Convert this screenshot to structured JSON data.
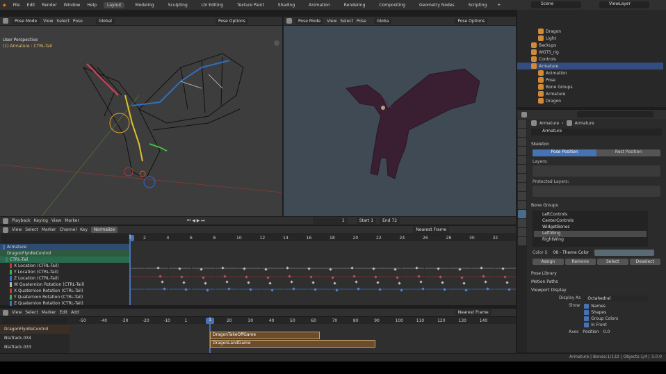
{
  "menu": {
    "items": [
      "File",
      "Edit",
      "Render",
      "Window",
      "Help"
    ],
    "workspaces": [
      "Layout",
      "Modeling",
      "Sculpting",
      "UV Editing",
      "Texture Paint",
      "Shading",
      "Animation",
      "Rendering",
      "Compositing",
      "Geometry Nodes",
      "Scripting"
    ],
    "active_workspace": "Layout",
    "scene": "Scene",
    "view_layer": "ViewLayer",
    "add_tab": "+"
  },
  "viewport_left": {
    "mode": "Pose Mode",
    "menus": [
      "View",
      "Select",
      "Pose"
    ],
    "orientation": "Global",
    "pose_options": "Pose Options",
    "perspective": "User Perspective",
    "object": "(1) Armature : CTRL-Tail"
  },
  "viewport_right": {
    "mode": "Pose Mode",
    "menus": [
      "View",
      "Select",
      "Pose"
    ],
    "orientation": "Globa",
    "pose_options": "Pose Options"
  },
  "outliner": {
    "rows": [
      {
        "name": "Dragon",
        "depth": 2
      },
      {
        "name": "Light",
        "depth": 2
      },
      {
        "name": "Backups",
        "depth": 1
      },
      {
        "name": "WGTS_rig",
        "depth": 1
      },
      {
        "name": "Controls",
        "depth": 1
      },
      {
        "name": "Armature",
        "depth": 1,
        "selected": true
      },
      {
        "name": "Animation",
        "depth": 2
      },
      {
        "name": "Pose",
        "depth": 2
      },
      {
        "name": "Bone Groups",
        "depth": 2
      },
      {
        "name": "Armature",
        "depth": 2
      },
      {
        "name": "Dragon",
        "depth": 2
      }
    ]
  },
  "properties": {
    "breadcrumb_obj": "Armature",
    "breadcrumb_data": "Armature",
    "name_field": "Armature",
    "skeleton": "Skeleton",
    "pose_position": "Pose Position",
    "rest_position": "Rest Position",
    "layers": "Layers:",
    "protected_layers": "Protected Layers:",
    "bone_groups": "Bone Groups",
    "groups": [
      "LeftControls",
      "CenterControls",
      "WidgetBones",
      "LeftWing",
      "RightWing"
    ],
    "selected_group": "LeftWing",
    "color_set_label": "Color S",
    "color_set_value": "08 - Theme Color",
    "buttons": [
      "Assign",
      "Remove",
      "Select",
      "Deselect"
    ],
    "pose_library": "Pose Library",
    "motion_paths": "Motion Paths",
    "viewport_display": "Viewport Display",
    "display_as_label": "Display As",
    "display_as_value": "Octahedral",
    "show_label": "Show",
    "show_items": [
      "Names",
      "Shapes",
      "Group Colors",
      "In Front"
    ],
    "axes_label": "Axes",
    "axes_value": "Position",
    "axes_num": "0.0"
  },
  "dopesheet": {
    "playback": "Playback",
    "keying": "Keying",
    "view": "View",
    "marker": "Marker",
    "current_frame": "1",
    "start_label": "Start",
    "start": "1",
    "end_label": "End",
    "end": "72",
    "menus": [
      "View",
      "Select",
      "Marker",
      "Channel",
      "Key"
    ],
    "mode": "Normalize",
    "snap": "Nearest Frame",
    "ticks": [
      "2",
      "4",
      "6",
      "8",
      "10",
      "12",
      "14",
      "16",
      "18",
      "20",
      "22",
      "24",
      "26",
      "28",
      "30",
      "32"
    ],
    "playhead": "1",
    "channels": [
      {
        "name": "Armature",
        "color": "#3d6fb5"
      },
      {
        "name": "DragonFlyIdleControl",
        "color": "#2d5a3f"
      },
      {
        "name": "CTRL-Tail",
        "color": "#2d8a5f"
      },
      {
        "name": "X Location (CTRL-Tail)",
        "color": "#c23b3b"
      },
      {
        "name": "Y Location (CTRL-Tail)",
        "color": "#3bb34a"
      },
      {
        "name": "Z Location (CTRL-Tail)",
        "color": "#3b6fd1"
      },
      {
        "name": "W Quaternion Rotation (CTRL-Tail)",
        "color": "#b8b8b8"
      },
      {
        "name": "X Quaternion Rotation (CTRL-Tail)",
        "color": "#c23b3b"
      },
      {
        "name": "Y Quaternion Rotation (CTRL-Tail)",
        "color": "#3bb34a"
      },
      {
        "name": "Z Quaternion Rotation (CTRL-Tail)",
        "color": "#3b6fd1"
      }
    ]
  },
  "nla": {
    "menus": [
      "View",
      "Select",
      "Marker",
      "Edit",
      "Add"
    ],
    "snap": "Nearest Frame",
    "ticks": [
      "-50",
      "-40",
      "-30",
      "-20",
      "-10",
      "1",
      "10",
      "20",
      "30",
      "40",
      "50",
      "60",
      "70",
      "80",
      "90",
      "100",
      "110",
      "120",
      "130",
      "140"
    ],
    "playhead": "1",
    "tracks": [
      {
        "name": "DragonFlyIdleControl"
      },
      {
        "name": "NlaTrack.034"
      },
      {
        "name": "NlaTrack.033"
      }
    ],
    "strips": [
      "DragonTakeOffGame",
      "DragonLandGame"
    ]
  },
  "status": {
    "text": "Armature | Bones:1/132 | Objects:1/4 | 3.0.0"
  }
}
